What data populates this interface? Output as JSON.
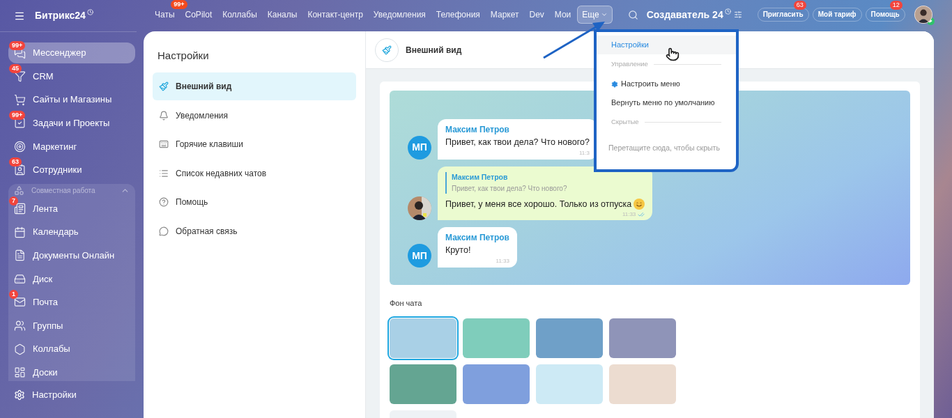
{
  "sidebar": {
    "logo": "Битрикс24",
    "items": [
      {
        "label": "Мессенджер",
        "badge": "99+",
        "selected": true
      },
      {
        "label": "CRM",
        "badge": "45",
        "selected": false
      },
      {
        "label": "Сайты и Магазины",
        "selected": false
      },
      {
        "label": "Задачи и Проекты",
        "badge": "99+",
        "selected": false
      },
      {
        "label": "Маркетинг",
        "selected": false
      },
      {
        "label": "Сотрудники",
        "badge": "63",
        "selected": false
      }
    ],
    "group": {
      "title": "Совместная работа",
      "expanded": true,
      "items": [
        {
          "label": "Лента",
          "badge": "7",
          "selected": false
        },
        {
          "label": "Календарь",
          "selected": false
        },
        {
          "label": "Документы Онлайн",
          "selected": false
        },
        {
          "label": "Диск",
          "selected": false
        },
        {
          "label": "Почта",
          "badge": "1",
          "selected": false
        },
        {
          "label": "Группы",
          "selected": false
        },
        {
          "label": "Коллабы",
          "selected": false
        },
        {
          "label": "Доски",
          "selected": false
        }
      ]
    },
    "footer": "Настройки"
  },
  "topbar": {
    "nav": [
      {
        "label": "Чаты",
        "badge": "99+",
        "selected": false
      },
      {
        "label": "CoPilot",
        "selected": false
      },
      {
        "label": "Коллабы",
        "selected": false
      },
      {
        "label": "Каналы",
        "selected": false
      },
      {
        "label": "Контакт-центр",
        "selected": false
      },
      {
        "label": "Уведомления",
        "selected": false
      },
      {
        "label": "Телефония",
        "selected": false
      },
      {
        "label": "Маркет",
        "selected": false
      },
      {
        "label": "Dev",
        "selected": false
      },
      {
        "label": "Мои",
        "selected": false
      },
      {
        "label": "Еще",
        "selected": true
      }
    ],
    "portal": "Создаватель 24",
    "buttons": [
      {
        "label": "Пригласить",
        "badge": "63"
      },
      {
        "label": "Мой тариф"
      },
      {
        "label": "Помощь",
        "badge": "12"
      }
    ]
  },
  "settings": {
    "title": "Настройки",
    "items": [
      {
        "label": "Внешний вид",
        "selected": true
      },
      {
        "label": "Уведомления",
        "selected": false
      },
      {
        "label": "Горячие клавиши",
        "selected": false
      },
      {
        "label": "Список недавних чатов",
        "selected": false
      },
      {
        "label": "Помощь",
        "selected": false
      },
      {
        "label": "Обратная связь",
        "selected": false
      }
    ]
  },
  "content": {
    "title": "Внешний вид",
    "messages": [
      {
        "kind": "incoming",
        "initials": "МП",
        "author": "Максим Петров",
        "text": "Привет, как твои дела? Что нового?",
        "time": "11:3"
      },
      {
        "kind": "outgoing",
        "quote_author": "Максим Петров",
        "quote_text": "Привет, как твои дела? Что нового?",
        "text": "Привет, у меня все хорошо. Только из отпуска",
        "time": "11:33",
        "read": true
      },
      {
        "kind": "incoming",
        "initials": "МП",
        "author": "Максим Петров",
        "text": "Круто!",
        "time": "11:33"
      }
    ],
    "background_title": "Фон чата",
    "swatches": [
      {
        "color": "#a9d0e6",
        "selected": true
      },
      {
        "color": "#7fcdbb",
        "selected": false
      },
      {
        "color": "#6fa0c8",
        "selected": false
      },
      {
        "color": "#8f94b8",
        "selected": false
      },
      {
        "color": "#64a592",
        "selected": false
      },
      {
        "color": "#7f9fdd",
        "selected": false
      },
      {
        "color": "#cdeaf5",
        "selected": false
      },
      {
        "color": "#ecdcd0",
        "selected": false
      },
      {
        "color": "#eef2f5",
        "selected": false
      }
    ]
  },
  "menu": {
    "items": [
      {
        "kind": "link",
        "label": "Настройки",
        "selected": true
      },
      {
        "kind": "section",
        "label": "Управление"
      },
      {
        "kind": "gear-link",
        "label": "Настроить меню",
        "selected": false
      },
      {
        "kind": "link",
        "label": "Вернуть меню по умолчанию",
        "selected": false
      },
      {
        "kind": "section",
        "label": "Скрытые"
      },
      {
        "kind": "hint",
        "label": "Перетащите сюда, чтобы скрыть"
      }
    ]
  }
}
